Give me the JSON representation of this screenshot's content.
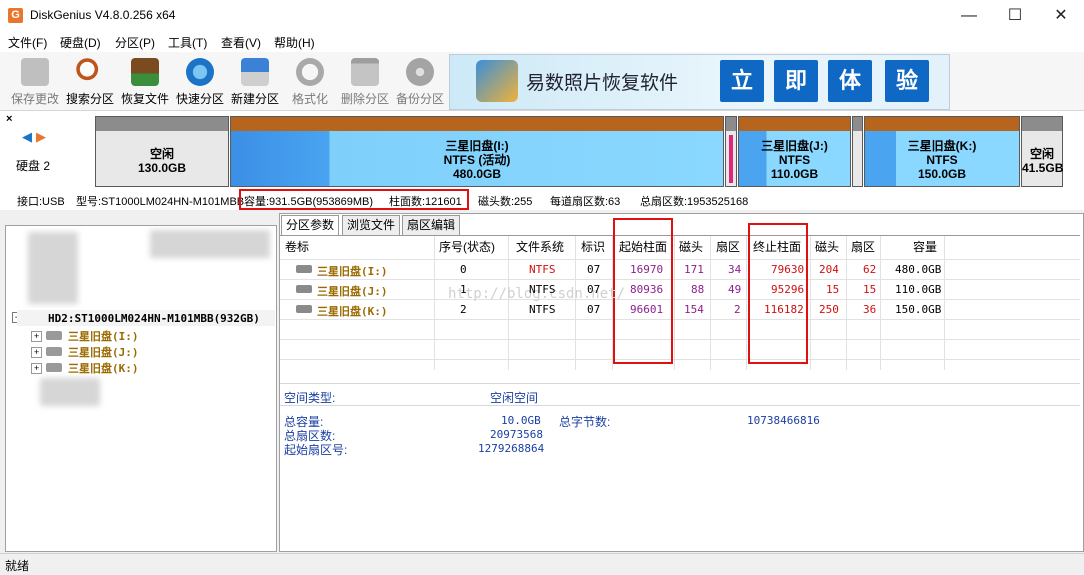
{
  "window": {
    "title": "DiskGenius V4.8.0.256 x64",
    "icon_letter": "G",
    "controls": {
      "minimize": "—",
      "maximize": "☐",
      "close": "✕"
    }
  },
  "menu": [
    "文件(F)",
    "硬盘(D)",
    "分区(P)",
    "工具(T)",
    "查看(V)",
    "帮助(H)"
  ],
  "toolbar": [
    {
      "label": "保存更改",
      "icon": "save-icon",
      "enabled": false,
      "color": "#8a8a8a"
    },
    {
      "label": "搜索分区",
      "icon": "magnifier-icon",
      "enabled": true,
      "color": "#c0551c"
    },
    {
      "label": "恢复文件",
      "icon": "recover-icon",
      "enabled": true,
      "color": "#2f8a2f"
    },
    {
      "label": "快速分区",
      "icon": "quick-partition-icon",
      "enabled": true,
      "color": "#1b74c7"
    },
    {
      "label": "新建分区",
      "icon": "new-partition-icon",
      "enabled": true,
      "color": "#2e6fc0"
    },
    {
      "label": "格式化",
      "icon": "format-icon",
      "enabled": false,
      "color": "#9a9a9a"
    },
    {
      "label": "删除分区",
      "icon": "delete-icon",
      "enabled": false,
      "color": "#9a9a9a"
    },
    {
      "label": "备份分区",
      "icon": "backup-icon",
      "enabled": false,
      "color": "#9a9a9a"
    }
  ],
  "banner": {
    "text": "易数照片恢复软件",
    "buttons": [
      "立",
      "即",
      "体",
      "验"
    ]
  },
  "diskmap": {
    "disk_label": "硬盘 2",
    "partitions": [
      {
        "name": "空闲",
        "fs": "",
        "size": "130.0GB",
        "type": "free"
      },
      {
        "name": "三星旧盘(I:)",
        "fs": "NTFS (活动)",
        "size": "480.0GB",
        "type": "active"
      },
      {
        "name": "三星旧盘(J:)",
        "fs": "NTFS",
        "size": "110.0GB",
        "type": "normal"
      },
      {
        "name": "三星旧盘(K:)",
        "fs": "NTFS",
        "size": "150.0GB",
        "type": "normal"
      },
      {
        "name": "空闲",
        "fs": "",
        "size": "41.5GB",
        "type": "free"
      }
    ]
  },
  "infobar": {
    "interface": "接口:USB",
    "model": "型号:ST1000LM024HN-M101MBB",
    "capacity": "容量:931.5GB(953869MB)",
    "cylinders": "柱面数:121601",
    "heads": "磁头数:255",
    "sectors_per_track": "每道扇区数:63",
    "total_sectors": "总扇区数:1953525168"
  },
  "tree": {
    "disk": "HD2:ST1000LM024HN-M101MBB(932GB)",
    "partitions": [
      "三星旧盘(I:)",
      "三星旧盘(J:)",
      "三星旧盘(K:)"
    ]
  },
  "tabs": [
    "分区参数",
    "浏览文件",
    "扇区编辑"
  ],
  "table": {
    "headers": [
      "卷标",
      "序号(状态)",
      "文件系统",
      "标识",
      "起始柱面",
      "磁头",
      "扇区",
      "终止柱面",
      "磁头",
      "扇区",
      "容量"
    ],
    "rows": [
      [
        "三星旧盘(I:)",
        "0",
        "NTFS",
        "07",
        "16970",
        "171",
        "34",
        "79630",
        "204",
        "62",
        "480.0GB"
      ],
      [
        "三星旧盘(J:)",
        "1",
        "NTFS",
        "07",
        "80936",
        "88",
        "49",
        "95296",
        "15",
        "15",
        "110.0GB"
      ],
      [
        "三星旧盘(K:)",
        "2",
        "NTFS",
        "07",
        "96601",
        "154",
        "2",
        "116182",
        "250",
        "36",
        "150.0GB"
      ]
    ],
    "watermark": "http://blog.csdn.net/"
  },
  "details": {
    "space_type_label": "空间类型:",
    "space_type_value": "空闲空间",
    "total_capacity_label": "总容量:",
    "total_capacity_value": "10.0GB",
    "total_bytes_label": "总字节数:",
    "total_bytes_value": "10738466816",
    "total_sectors_label": "总扇区数:",
    "total_sectors_value": "20973568",
    "start_sector_label": "起始扇区号:",
    "start_sector_value": "1279268864"
  },
  "status": "就绪"
}
